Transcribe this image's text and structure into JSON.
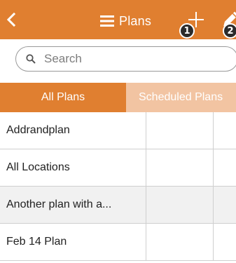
{
  "header": {
    "title": "Plans",
    "background_color": "#e07f30",
    "icons": {
      "back": "chevron-left-icon",
      "menu": "hamburger-menu-icon",
      "add": "plus-icon",
      "edit": "pencil-icon"
    },
    "callouts": [
      "1",
      "2"
    ]
  },
  "search": {
    "placeholder": "Search",
    "value": ""
  },
  "tabs": [
    {
      "label": "All Plans",
      "active": true
    },
    {
      "label": "Scheduled Plans",
      "active": false
    }
  ],
  "plans": [
    {
      "name": "Addrandplan"
    },
    {
      "name": "All Locations"
    },
    {
      "name": "Another plan with a..."
    },
    {
      "name": "Feb 14 Plan"
    }
  ]
}
